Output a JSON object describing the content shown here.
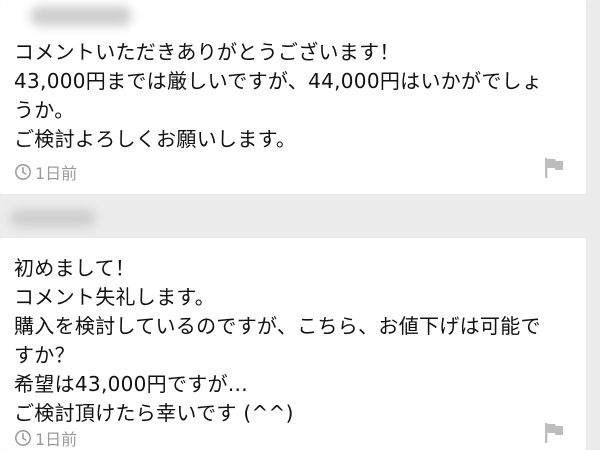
{
  "comments": [
    {
      "lines": [
        "コメントいただきありがとうございます！",
        "43,000円までは厳しいですが、44,000円はいかがでしょ",
        "うか。",
        "ご検討よろしくお願いします。"
      ],
      "time": "1日前",
      "time_icon": "clock-icon",
      "action_icon": "flag-icon"
    },
    {
      "lines": [
        "初めまして！",
        "コメント失礼します。",
        "購入を検討しているのですが、こちら、お値下げは可能で",
        "すか？",
        "希望は43,000円ですが...",
        "ご検討頂けたら幸いです (^^)"
      ],
      "time": "1日前",
      "time_icon": "clock-icon",
      "action_icon": "flag-icon"
    }
  ],
  "colors": {
    "background": "#ececec",
    "card": "#ffffff",
    "text": "#111111",
    "meta": "#9a9a9a"
  }
}
